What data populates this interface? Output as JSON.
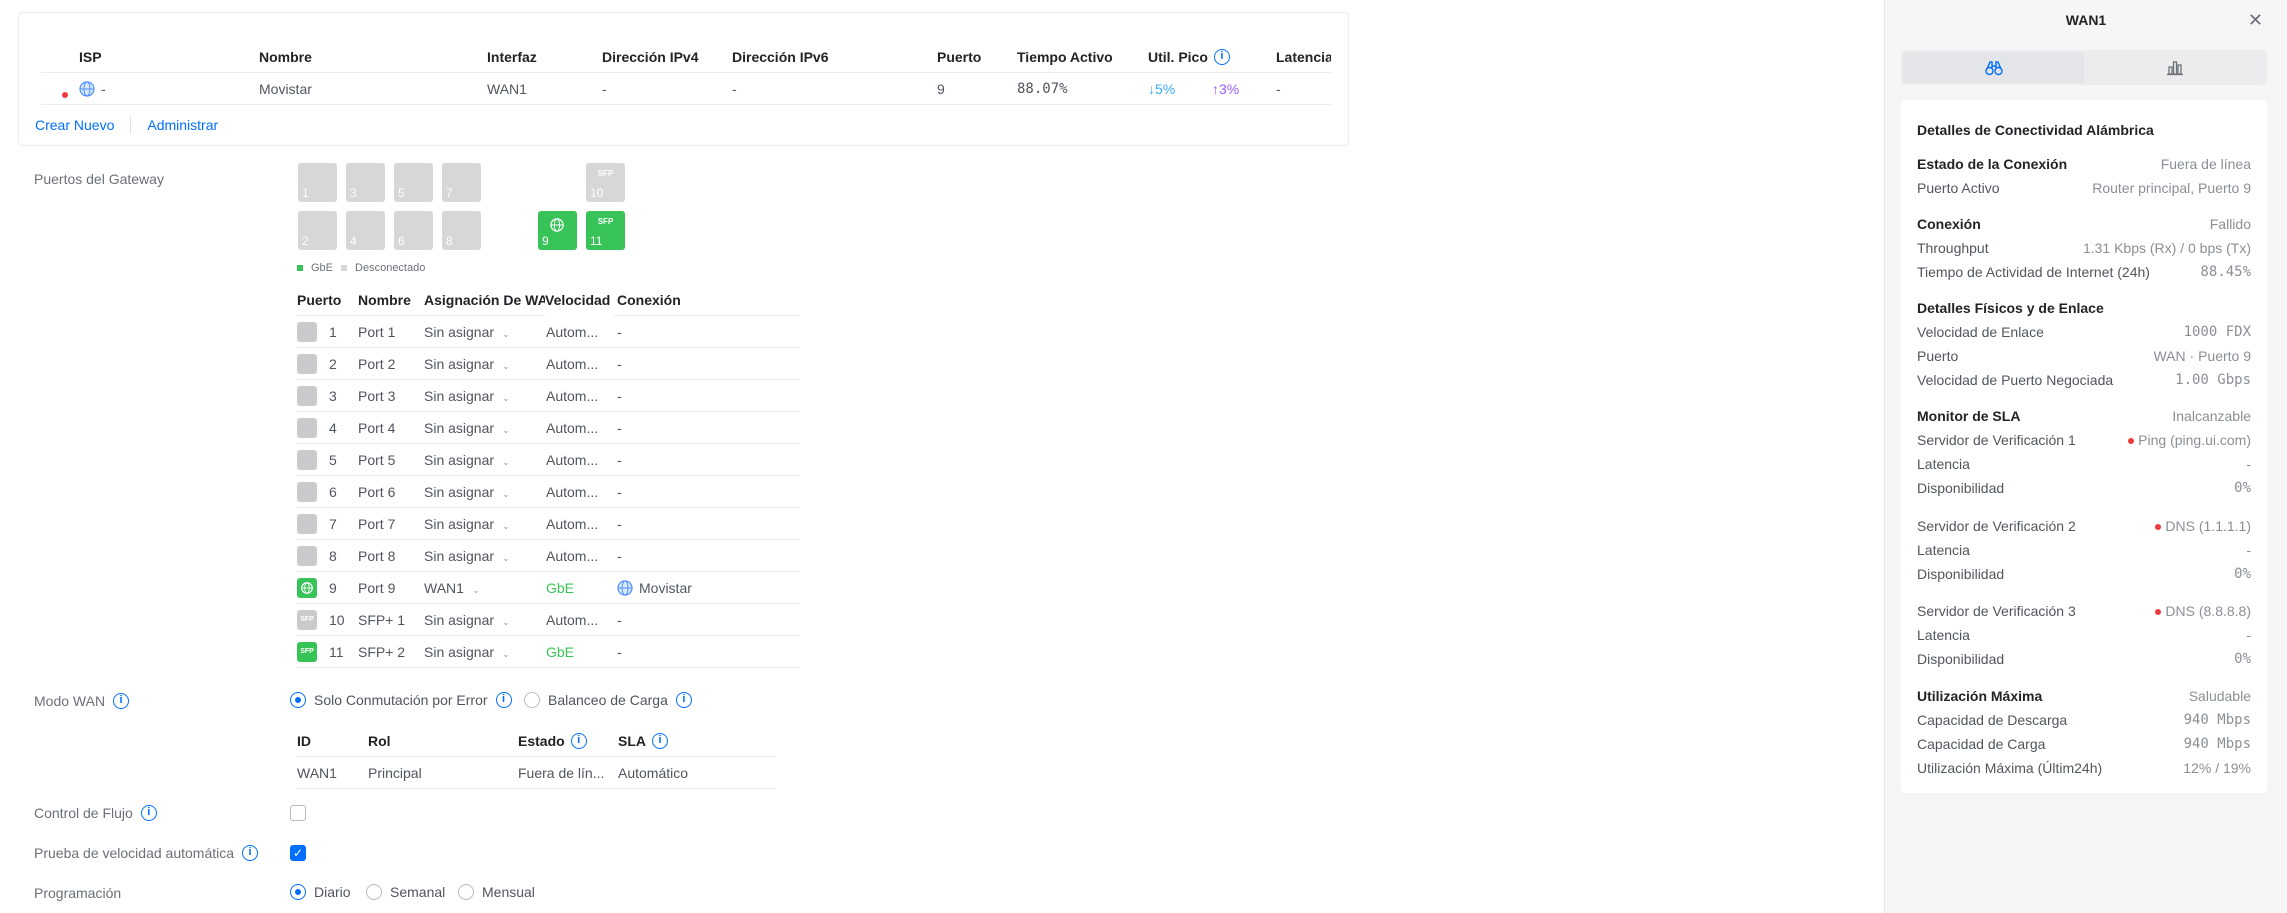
{
  "isp_table": {
    "headers": [
      "ISP",
      "Nombre",
      "Interfaz",
      "Dirección IPv4",
      "Dirección IPv6",
      "Puerto",
      "Tiempo Activo",
      "Util. Pico",
      "Latencia"
    ],
    "row": {
      "isp": "-",
      "nombre": "Movistar",
      "interfaz": "WAN1",
      "ipv4": "-",
      "ipv6": "-",
      "puerto": "9",
      "tiempo_activo": "88.07%",
      "util_down": "↓5%",
      "util_up": "↑3%",
      "latencia": "-"
    },
    "links": {
      "create": "Crear Nuevo",
      "manage": "Administrar"
    }
  },
  "gateway_ports": {
    "label": "Puertos del Gateway",
    "top_row": [
      "1",
      "3",
      "5",
      "7",
      "10"
    ],
    "bottom_row": [
      "2",
      "4",
      "6",
      "8",
      "9",
      "11"
    ],
    "sfp_badge": "SFP",
    "legend": {
      "gbe": "GbE",
      "disconnected": "Desconectado"
    },
    "legend_colors": {
      "gbe": "#38c359",
      "disconnected": "#d6d7d9"
    }
  },
  "ports_table": {
    "headers": {
      "port": "Puerto",
      "name": "Nombre",
      "wan": "Asignación De WAN",
      "speed": "Velocidad",
      "conn": "Conexión"
    },
    "rows": [
      {
        "num": "1",
        "name": "Port 1",
        "wan": "Sin asignar",
        "speed": "Autom...",
        "conn": "-"
      },
      {
        "num": "2",
        "name": "Port 2",
        "wan": "Sin asignar",
        "speed": "Autom...",
        "conn": "-"
      },
      {
        "num": "3",
        "name": "Port 3",
        "wan": "Sin asignar",
        "speed": "Autom...",
        "conn": "-"
      },
      {
        "num": "4",
        "name": "Port 4",
        "wan": "Sin asignar",
        "speed": "Autom...",
        "conn": "-"
      },
      {
        "num": "5",
        "name": "Port 5",
        "wan": "Sin asignar",
        "speed": "Autom...",
        "conn": "-"
      },
      {
        "num": "6",
        "name": "Port 6",
        "wan": "Sin asignar",
        "speed": "Autom...",
        "conn": "-"
      },
      {
        "num": "7",
        "name": "Port 7",
        "wan": "Sin asignar",
        "speed": "Autom...",
        "conn": "-"
      },
      {
        "num": "8",
        "name": "Port 8",
        "wan": "Sin asignar",
        "speed": "Autom...",
        "conn": "-"
      },
      {
        "num": "9",
        "name": "Port 9",
        "wan": "WAN1",
        "speed": "GbE",
        "conn": "Movistar"
      },
      {
        "num": "10",
        "name": "SFP+ 1",
        "wan": "Sin asignar",
        "speed": "Autom...",
        "conn": "-"
      },
      {
        "num": "11",
        "name": "SFP+ 2",
        "wan": "Sin asignar",
        "speed": "GbE",
        "conn": "-"
      }
    ]
  },
  "wan_mode": {
    "label": "Modo WAN",
    "options": [
      "Solo Conmutación por Error",
      "Balanceo de Carga"
    ],
    "selected": "Solo Conmutación por Error",
    "table": {
      "headers": {
        "id": "ID",
        "rol": "Rol",
        "estado": "Estado",
        "sla": "SLA"
      },
      "row": {
        "id": "WAN1",
        "rol": "Principal",
        "estado": "Fuera de lín...",
        "sla": "Automático"
      }
    }
  },
  "flow_control": {
    "label": "Control de Flujo",
    "checked": false
  },
  "speed_test": {
    "label": "Prueba de velocidad automática",
    "checked": true
  },
  "schedule": {
    "label": "Programación",
    "options": [
      "Diario",
      "Semanal",
      "Mensual"
    ],
    "selected": "Diario"
  },
  "panel": {
    "title": "WAN1",
    "tabs": [
      {
        "icon": "binoculars-icon"
      },
      {
        "icon": "bar-chart-icon"
      }
    ],
    "card_title": "Detalles de Conectividad Alámbrica",
    "connection_state": {
      "label": "Estado de la Conexión",
      "value": "Fuera de línea"
    },
    "active_port": {
      "label": "Puerto Activo",
      "value": "Router principal, Puerto 9"
    },
    "connection": {
      "label": "Conexión",
      "value": "Fallido"
    },
    "throughput": {
      "label": "Throughput",
      "value": "1.31 Kbps (Rx) / 0 bps (Tx)"
    },
    "uptime": {
      "label": "Tiempo de Actividad de Internet (24h)",
      "value": "88.45%"
    },
    "physical": {
      "label": "Detalles Físicos y de Enlace"
    },
    "link_speed": {
      "label": "Velocidad de Enlace",
      "value": "1000 FDX"
    },
    "port": {
      "label": "Puerto",
      "value": "WAN · Puerto 9"
    },
    "negotiated": {
      "label": "Velocidad de Puerto Negociada",
      "value": "1.00 Gbps"
    },
    "sla": {
      "label": "Monitor de SLA",
      "value": "Inalcanzable"
    },
    "servers": [
      {
        "label": "Servidor de Verificación 1",
        "value": "Ping (ping.ui.com)",
        "latency_label": "Latencia",
        "latency": "-",
        "avail_label": "Disponibilidad",
        "avail": "0%"
      },
      {
        "label": "Servidor de Verificación 2",
        "value": "DNS (1.1.1.1)",
        "latency_label": "Latencia",
        "latency": "-",
        "avail_label": "Disponibilidad",
        "avail": "0%"
      },
      {
        "label": "Servidor de Verificación 3",
        "value": "DNS (8.8.8.8)",
        "latency_label": "Latencia",
        "latency": "-",
        "avail_label": "Disponibilidad",
        "avail": "0%"
      }
    ],
    "max_util": {
      "label": "Utilización Máxima",
      "value": "Saludable"
    },
    "download": {
      "label": "Capacidad de Descarga",
      "value": "940 Mbps"
    },
    "upload": {
      "label": "Capacidad de Carga",
      "value": "940 Mbps"
    },
    "max_util_24h": {
      "label": "Utilización Máxima (Últim24h)",
      "value": "12% / 19%"
    }
  },
  "colors": {
    "accent": "#006fff",
    "error": "#ee3a3a",
    "ok": "#38c359",
    "port_off": "#d6d7d9"
  }
}
